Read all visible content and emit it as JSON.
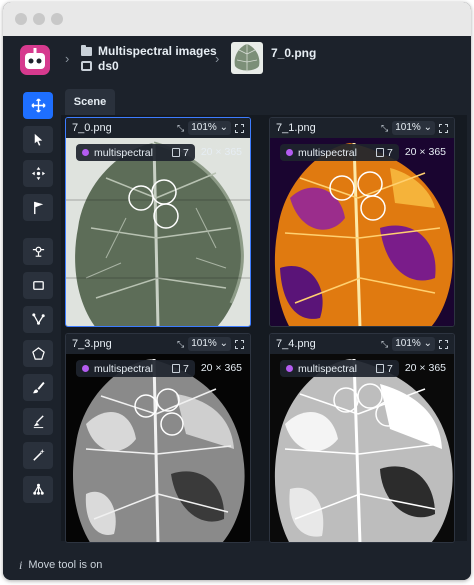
{
  "window": {
    "title": ""
  },
  "breadcrumb": {
    "project": "Multispectral images",
    "dataset": "ds0",
    "image": "7_0.png"
  },
  "scene_tab": "Scene",
  "tools": [
    {
      "name": "move-tool",
      "icon": "move-icon",
      "active": true
    },
    {
      "name": "select-tool",
      "icon": "cursor-icon",
      "active": false
    },
    {
      "name": "pan-tool",
      "icon": "pan-icon",
      "active": false
    },
    {
      "name": "flag-tool",
      "icon": "flag-icon",
      "active": false
    },
    {
      "name": "point-tool",
      "icon": "point-icon",
      "active": false
    },
    {
      "name": "rectangle-tool",
      "icon": "rectangle-icon",
      "active": false
    },
    {
      "name": "polyline-tool",
      "icon": "polyline-icon",
      "active": false
    },
    {
      "name": "polygon-tool",
      "icon": "polygon-icon",
      "active": false
    },
    {
      "name": "brush-tool",
      "icon": "brush-icon",
      "active": false
    },
    {
      "name": "eraser-tool",
      "icon": "eraser-icon",
      "active": false
    },
    {
      "name": "magic-wand-tool",
      "icon": "magic-wand-icon",
      "active": false
    },
    {
      "name": "graph-tool",
      "icon": "graph-icon",
      "active": false
    }
  ],
  "cells": [
    {
      "name": "7_0.png",
      "zoom": "101%",
      "tag": "multispectral",
      "layers": "7",
      "dims": "20 × 365",
      "selected": true
    },
    {
      "name": "7_1.png",
      "zoom": "101%",
      "tag": "multispectral",
      "layers": "7",
      "dims": "20 × 365",
      "selected": false
    },
    {
      "name": "7_3.png",
      "zoom": "101%",
      "tag": "multispectral",
      "layers": "7",
      "dims": "20 × 365",
      "selected": false
    },
    {
      "name": "7_4.png",
      "zoom": "101%",
      "tag": "multispectral",
      "layers": "7",
      "dims": "20 × 365",
      "selected": false
    }
  ],
  "status": "Move tool is on",
  "colors": {
    "accent": "#1e6fff",
    "tag": "#b45cf0",
    "background": "#1c222b"
  }
}
